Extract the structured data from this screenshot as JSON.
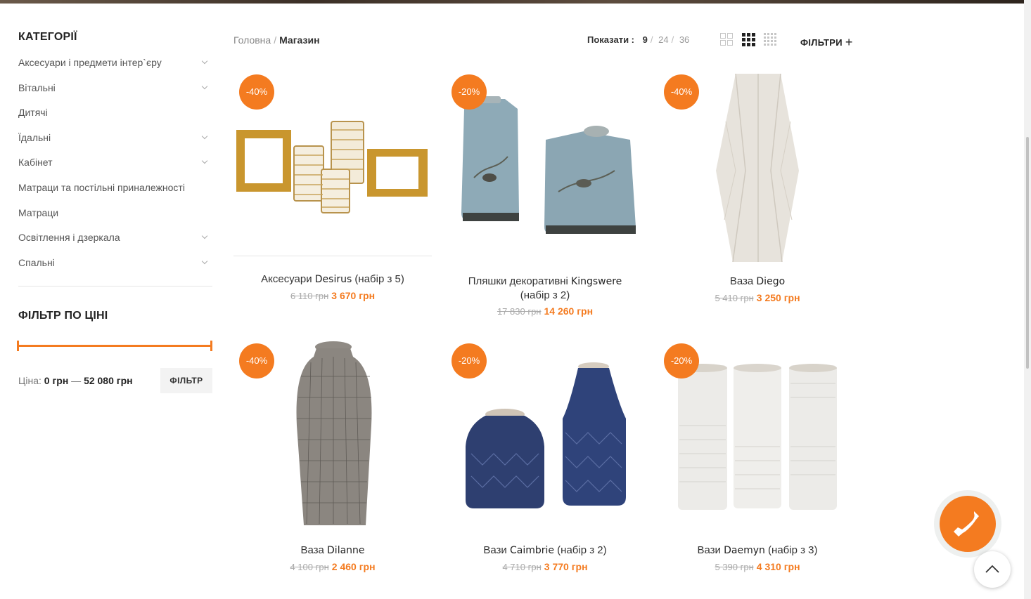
{
  "sidebar": {
    "categories_title": "КАТЕГОРІЇ",
    "categories": [
      {
        "label": "Аксесуари і предмети інтер`єру",
        "has_children": true
      },
      {
        "label": "Вітальні",
        "has_children": true
      },
      {
        "label": "Дитячі",
        "has_children": false
      },
      {
        "label": "Їдальні",
        "has_children": true
      },
      {
        "label": "Кабінет",
        "has_children": true
      },
      {
        "label": "Матраци та постільні приналежності",
        "has_children": false
      },
      {
        "label": "Матраци",
        "has_children": false
      },
      {
        "label": "Освітлення і дзеркала",
        "has_children": true
      },
      {
        "label": "Спальні",
        "has_children": true
      }
    ],
    "price_filter": {
      "title": "ФІЛЬТР ПО ЦІНІ",
      "price_prefix": "Ціна:",
      "min": "0 грн",
      "dash": "—",
      "max": "52 080 грн",
      "button": "ФІЛЬТР"
    }
  },
  "breadcrumb": {
    "home": "Головна",
    "separator": "/",
    "current": "Магазин"
  },
  "toolbar": {
    "show_label": "Показати :",
    "per_page": [
      "9",
      "24",
      "36"
    ],
    "active_per_page": "9",
    "filters_label": "ФІЛЬТРИ",
    "filters_icon": "+"
  },
  "accent_color": "#f47b20",
  "products": [
    {
      "badge": "-40%",
      "name_pre": "Аксесуари ",
      "name_brand": "Desirus",
      "name_post": " (набір з 5)",
      "old_price": "6 110 грн",
      "new_price": "3 670 грн",
      "image": "gold-frames-and-glasses"
    },
    {
      "badge": "-20%",
      "name_pre": "Пляшки декоративні ",
      "name_brand": "Kingswere",
      "name_post": " (набір з 2)",
      "old_price": "17 830 грн",
      "new_price": "14 260 грн",
      "image": "blue-bird-bottles"
    },
    {
      "badge": "-40%",
      "name_pre": "Ваза ",
      "name_brand": "Diego",
      "name_post": "",
      "old_price": "5 410 грн",
      "new_price": "3 250 грн",
      "image": "white-geometric-vase"
    },
    {
      "badge": "-40%",
      "name_pre": "Ваза ",
      "name_brand": "Dilanne",
      "name_post": "",
      "old_price": "4 100 грн",
      "new_price": "2 460 грн",
      "image": "grey-striped-vase"
    },
    {
      "badge": "-20%",
      "name_pre": "Вази ",
      "name_brand": "Caimbrie",
      "name_post": " (набір з 2)",
      "old_price": "4 710 грн",
      "new_price": "3 770 грн",
      "image": "navy-vases"
    },
    {
      "badge": "-20%",
      "name_pre": "Вази ",
      "name_brand": "Daemyn",
      "name_post": " (набір з 3)",
      "old_price": "5 390 грн",
      "new_price": "4 310 грн",
      "image": "white-cylinder-vases"
    }
  ]
}
